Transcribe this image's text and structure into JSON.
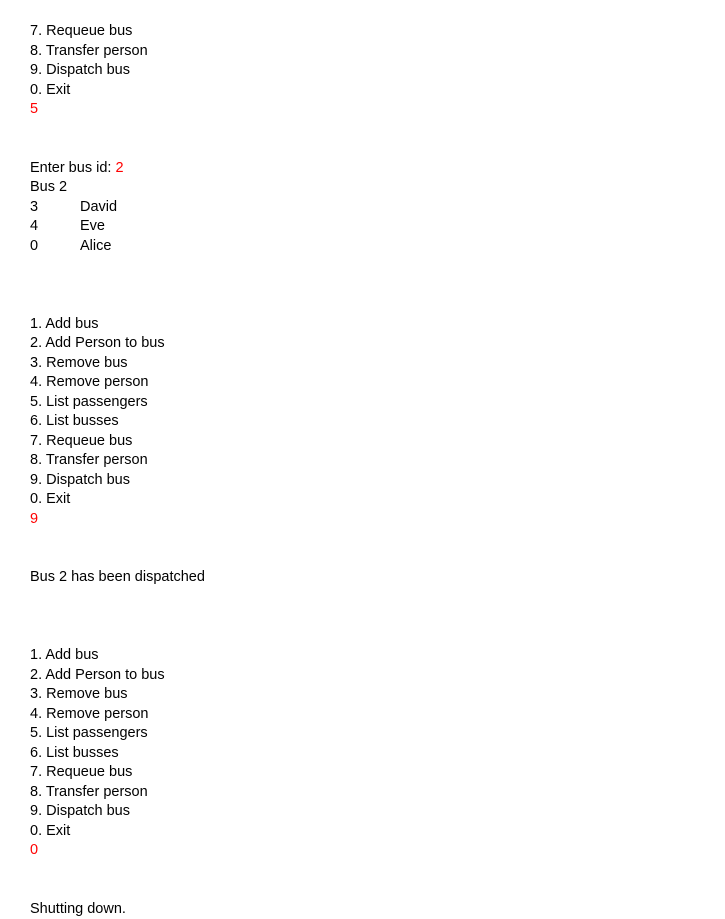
{
  "colors": {
    "text": "#000000",
    "user_input": "#ff0000",
    "background": "#ffffff"
  },
  "menu": {
    "options": [
      "1. Add bus",
      "2. Add Person to bus",
      "3. Remove bus",
      "4. Remove person",
      "5. List passengers",
      "6. List busses",
      "7. Requeue bus",
      "8. Transfer person",
      "9. Dispatch bus",
      "0. Exit"
    ]
  },
  "session": {
    "menu_top_partial": [
      "7. Requeue bus",
      "8. Transfer person",
      "9. Dispatch bus",
      "0. Exit"
    ],
    "choice_list_passengers": "5",
    "prompt_bus_id_label": "Enter bus id: ",
    "prompt_bus_id_value": "2",
    "bus_header": "Bus 2",
    "passengers": [
      {
        "id": "3",
        "name": "David"
      },
      {
        "id": "4",
        "name": "Eve"
      },
      {
        "id": "0",
        "name": "Alice"
      }
    ],
    "choice_dispatch": "9",
    "dispatch_message": "Bus 2 has been dispatched",
    "choice_exit": "0",
    "shutdown_message": "Shutting down."
  }
}
